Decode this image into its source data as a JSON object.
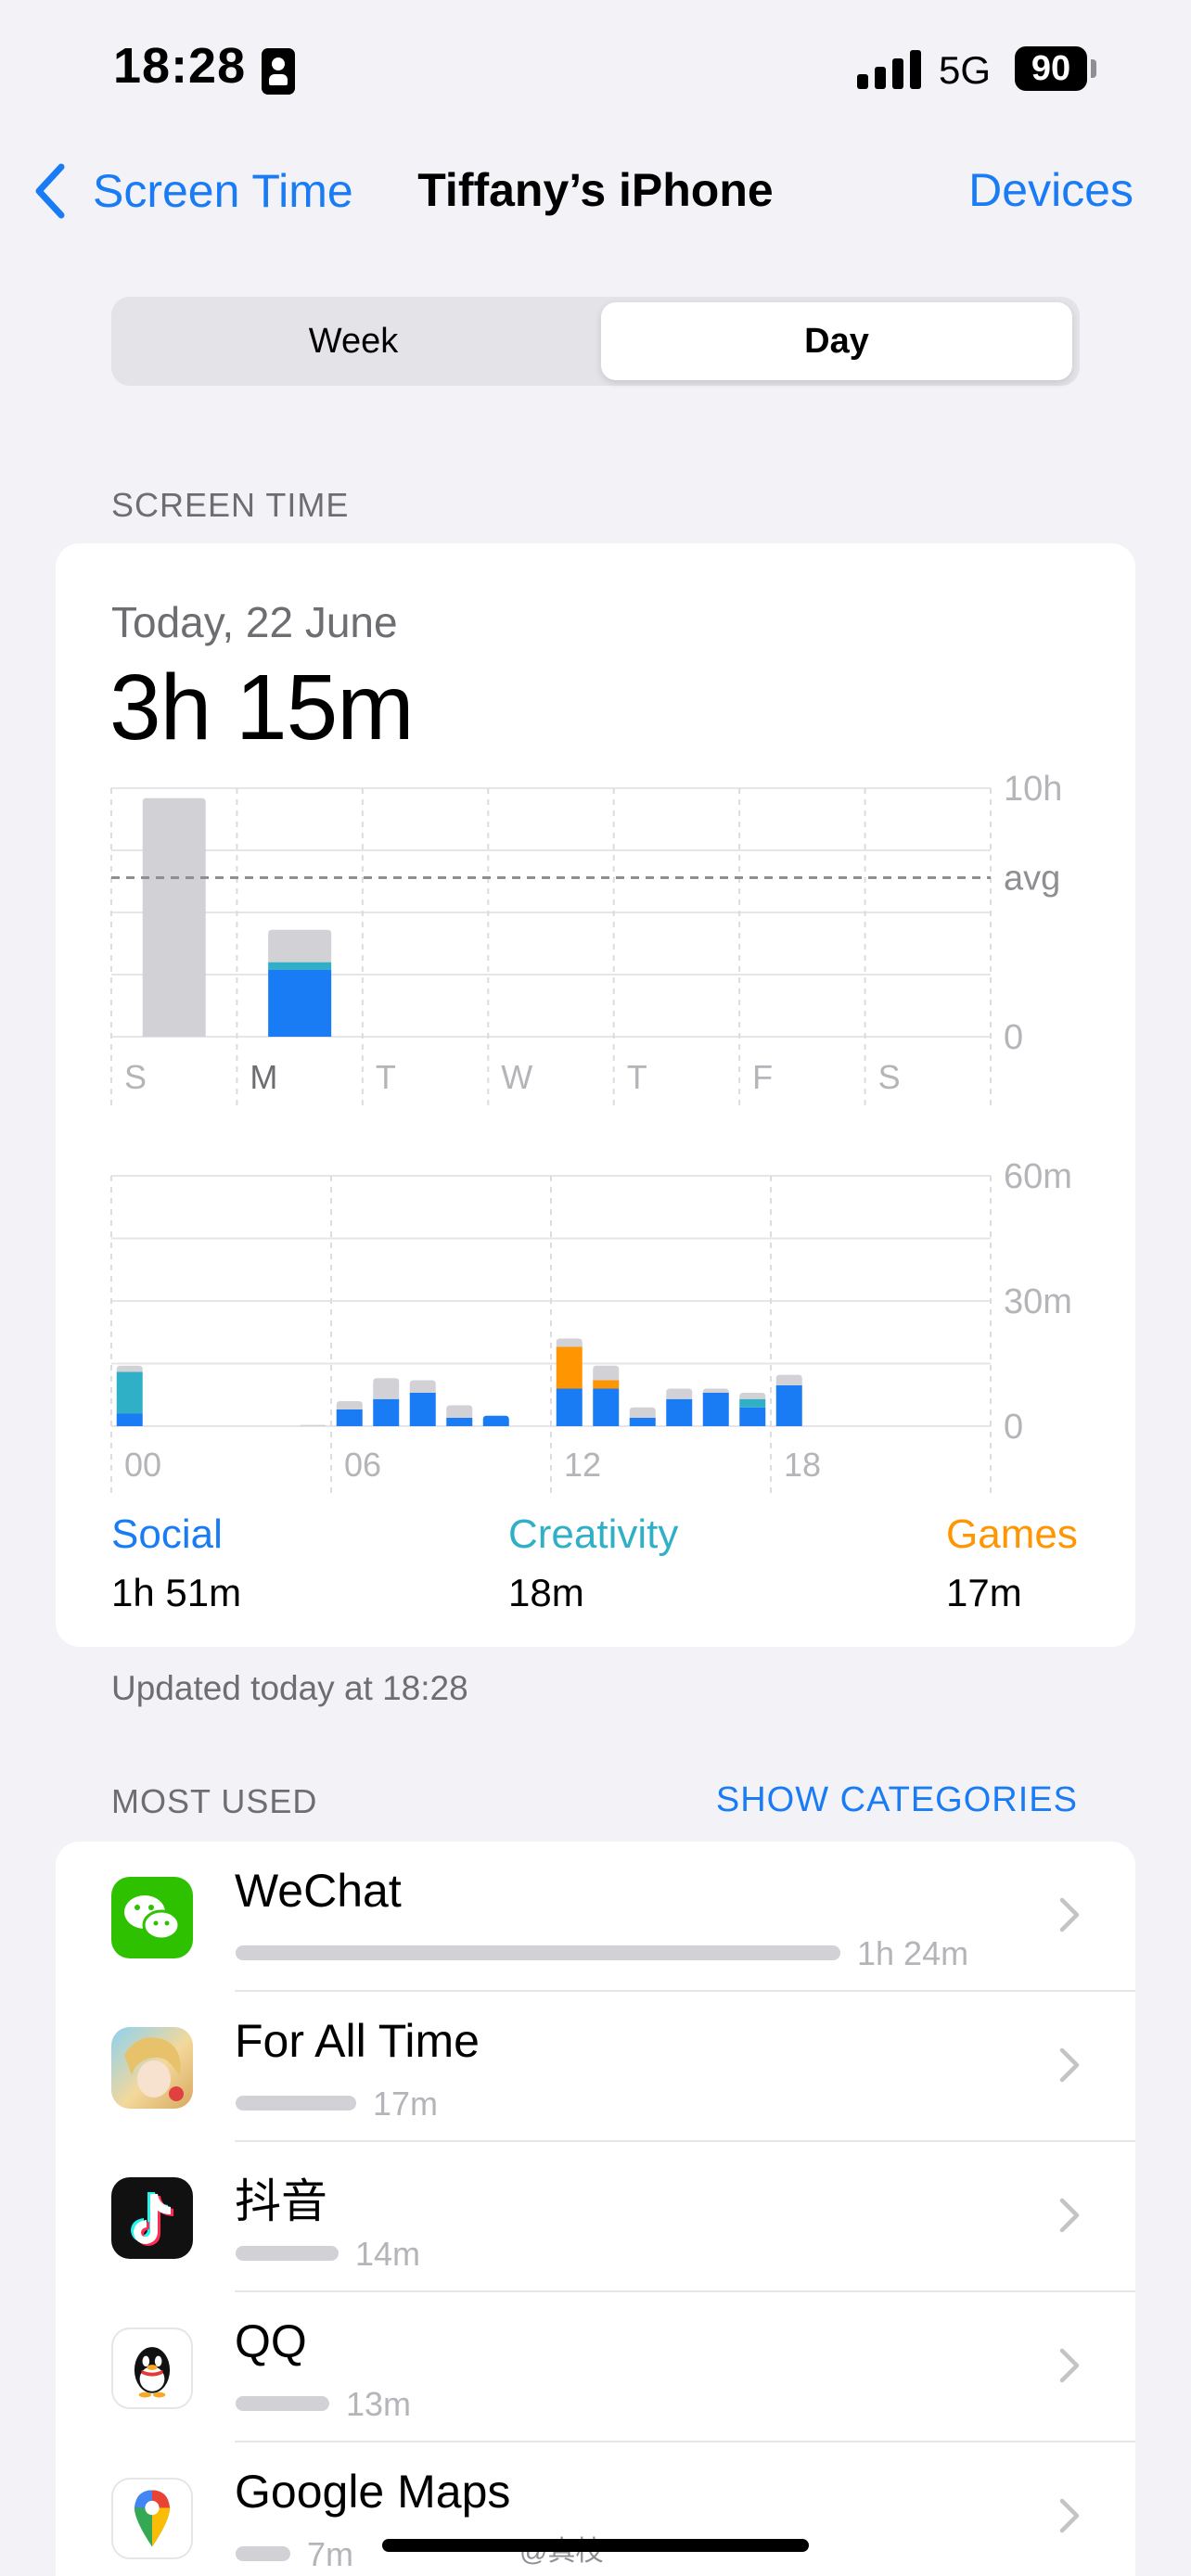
{
  "status_bar": {
    "time": "18:28",
    "network": "5G",
    "battery": "90"
  },
  "nav": {
    "back_label": "Screen Time",
    "title": "Tiffany’s iPhone",
    "right_label": "Devices"
  },
  "segmented": {
    "week_label": "Week",
    "day_label": "Day",
    "selected": "Day"
  },
  "screen_time": {
    "section_label": "SCREEN TIME",
    "date": "Today, 22 June",
    "total": "3h 15m",
    "updated": "Updated today at 18:28"
  },
  "chart_data": [
    {
      "type": "bar",
      "title": "",
      "categories": [
        "S",
        "M",
        "T",
        "W",
        "T",
        "F",
        "S"
      ],
      "series": [
        {
          "name": "Social",
          "color": "#1a7cf5",
          "values": [
            0,
            2.7,
            0,
            0,
            0,
            0,
            0
          ]
        },
        {
          "name": "Creativity",
          "color": "#30b0c7",
          "values": [
            0,
            0.3,
            0,
            0,
            0,
            0,
            0
          ]
        },
        {
          "name": "Other",
          "color": "#d1d1d6",
          "values": [
            9.6,
            1.3,
            0,
            0,
            0,
            0,
            0
          ]
        }
      ],
      "ylim": [
        0,
        10
      ],
      "y_tick_labels": [
        "10h",
        "avg",
        "0"
      ],
      "avg": 6.4,
      "grid": true
    },
    {
      "type": "bar",
      "title": "",
      "categories": [
        "00",
        "01",
        "02",
        "03",
        "04",
        "05",
        "06",
        "07",
        "08",
        "09",
        "10",
        "11",
        "12",
        "13",
        "14",
        "15",
        "16",
        "17",
        "18",
        "19",
        "20",
        "21",
        "22",
        "23"
      ],
      "x_tick_labels": [
        "00",
        "06",
        "12",
        "18"
      ],
      "series": [
        {
          "name": "Social",
          "color": "#1a7cf5",
          "values": [
            3,
            0,
            0,
            0,
            0,
            0,
            4,
            6.5,
            8,
            2,
            2.5,
            0,
            9,
            9,
            2,
            6.5,
            8,
            4.5,
            9.8,
            0,
            0,
            0,
            0,
            0
          ]
        },
        {
          "name": "Creativity",
          "color": "#30b0c7",
          "values": [
            10,
            0,
            0,
            0,
            0,
            0,
            0,
            0,
            0,
            0,
            0,
            0,
            0,
            0,
            0,
            0,
            0,
            2,
            0,
            0,
            0,
            0,
            0,
            0
          ]
        },
        {
          "name": "Games",
          "color": "#ff9500",
          "values": [
            0,
            0,
            0,
            0,
            0,
            0,
            0,
            0,
            0,
            0,
            0,
            0,
            10,
            2,
            0,
            0,
            0,
            0,
            0,
            0,
            0,
            0,
            0,
            0
          ]
        },
        {
          "name": "Other",
          "color": "#d1d1d6",
          "values": [
            1.5,
            0,
            0,
            0,
            0,
            0.3,
            2,
            5,
            3,
            3,
            0,
            0,
            2,
            3.5,
            2.5,
            2.5,
            1,
            1.5,
            2.5,
            0,
            0,
            0,
            0,
            0
          ]
        }
      ],
      "ylim": [
        0,
        60
      ],
      "y_tick_labels": [
        "60m",
        "30m",
        "0"
      ],
      "grid": true
    }
  ],
  "legend": [
    {
      "name": "Social",
      "value": "1h 51m",
      "color": "#1a7cf5"
    },
    {
      "name": "Creativity",
      "value": "18m",
      "color": "#30b0c7"
    },
    {
      "name": "Games",
      "value": "17m",
      "color": "#ff9500"
    }
  ],
  "most_used": {
    "section_label": "MOST USED",
    "toggle_label": "SHOW CATEGORIES",
    "apps": [
      {
        "name": "WeChat",
        "time": "1h 24m",
        "icon": "wechat-icon",
        "fraction": 1.0
      },
      {
        "name": "For All Time",
        "time": "17m",
        "icon": "for-all-time-icon",
        "fraction": 0.2
      },
      {
        "name": "抖音",
        "time": "14m",
        "icon": "douyin-icon",
        "fraction": 0.17
      },
      {
        "name": "QQ",
        "time": "13m",
        "icon": "qq-icon",
        "fraction": 0.155
      },
      {
        "name": "Google Maps",
        "time": "7m",
        "icon": "google-maps-icon",
        "fraction": 0.09
      }
    ]
  },
  "watermark": "@真枝"
}
